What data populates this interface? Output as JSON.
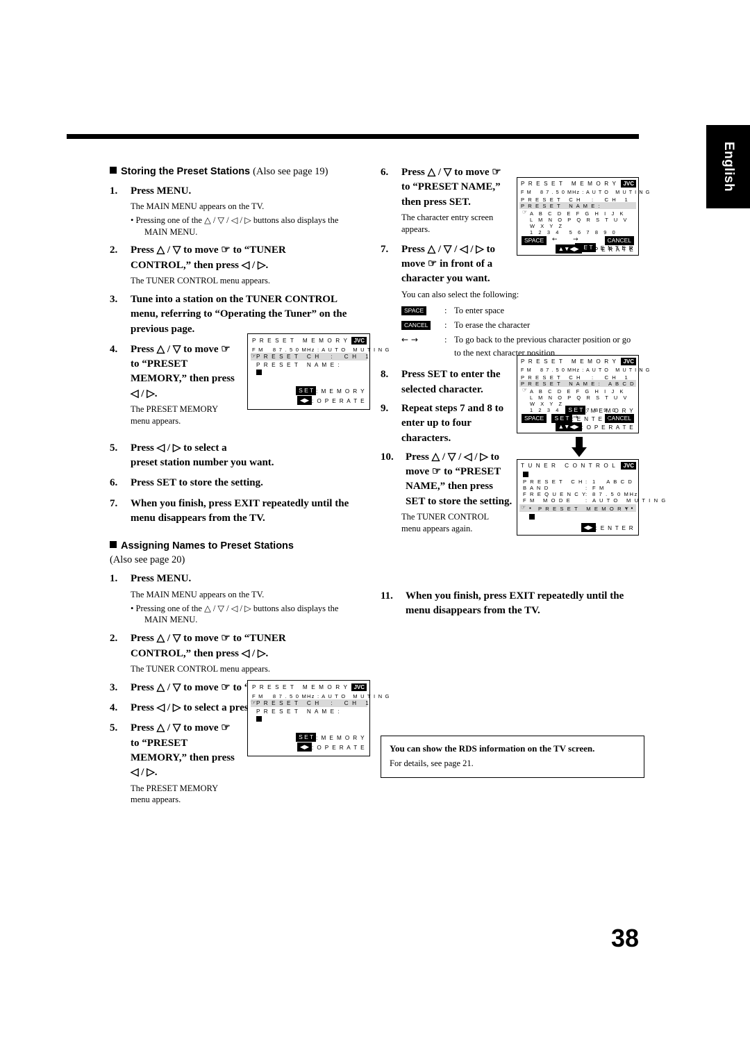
{
  "page": {
    "number": "38",
    "language_tab": "English"
  },
  "left_column": {
    "section1": {
      "title_bold": "Storing the Preset Stations",
      "title_thin": "(Also see page 19)",
      "steps": [
        {
          "num": "1.",
          "text": "Press MENU.",
          "note": "The MAIN MENU appears on the TV.",
          "bullet_line1": "• Pressing one of the △ / ▽ / ◁ / ▷ buttons also displays the",
          "bullet_line2": "MAIN MENU."
        },
        {
          "num": "2.",
          "text_line1": "Press △ / ▽ to move ☞ to “TUNER",
          "text_line2": "CONTROL,” then press ◁ / ▷.",
          "note": "The TUNER CONTROL menu appears."
        },
        {
          "num": "3.",
          "text_line1": "Tune into a station on the TUNER CONTROL",
          "text_line2": "menu, referring to “Operating the Tuner” on the",
          "text_line3": "previous page."
        },
        {
          "num": "4.",
          "text_line1": "Press △ / ▽ to move ☞",
          "text_line2": "to “PRESET",
          "text_line3": "MEMORY,” then press",
          "text_line4": "◁ / ▷.",
          "note_line1": "The PRESET MEMORY",
          "note_line2": "menu appears."
        },
        {
          "num": "5.",
          "text_line1": "Press ◁ / ▷ to select a",
          "text_line2": "preset station number you want."
        },
        {
          "num": "6.",
          "text": "Press SET to store the setting."
        },
        {
          "num": "7.",
          "text_line1": "When you finish, press EXIT repeatedly until the",
          "text_line2": "menu disappears from the TV."
        }
      ]
    },
    "section2": {
      "title_bold": "Assigning Names to Preset Stations",
      "title_thin": "(Also see page 20)",
      "steps": [
        {
          "num": "1.",
          "text": "Press MENU.",
          "note": "The MAIN MENU appears on the TV.",
          "bullet_line1": "• Pressing one of the △ / ▽ / ◁ / ▷ buttons also displays the",
          "bullet_line2": "MAIN MENU."
        },
        {
          "num": "2.",
          "text_line1": "Press △ / ▽ to move ☞ to “TUNER",
          "text_line2": "CONTROL,” then press ◁ / ▷.",
          "note": "The TUNER CONTROL menu appears."
        },
        {
          "num": "3.",
          "text": "Press △ / ▽ to move ☞ to “PRESET CH.”"
        },
        {
          "num": "4.",
          "text": "Press ◁ / ▷ to select a preset station."
        },
        {
          "num": "5.",
          "text_line1": "Press △ / ▽ to move ☞",
          "text_line2": "to “PRESET",
          "text_line3": "MEMORY,” then press",
          "text_line4": "◁ / ▷.",
          "note_line1": "The PRESET MEMORY",
          "note_line2": "menu appears."
        }
      ]
    }
  },
  "right_column": {
    "steps": [
      {
        "num": "6.",
        "text_line1": "Press △ / ▽ to move ☞",
        "text_line2": "to “PRESET NAME,”",
        "text_line3": "then press SET.",
        "note_line1": "The character entry screen",
        "note_line2": "appears."
      },
      {
        "num": "7.",
        "text_line1": "Press △ / ▽ / ◁ / ▷ to",
        "text_line2": "move ☞ in front of a",
        "text_line3": "character you want.",
        "note": "You can also select the following:"
      },
      {
        "num": "8.",
        "text_line1": "Press SET to enter the",
        "text_line2": "selected character."
      },
      {
        "num": "9.",
        "text_line1": "Repeat steps 7 and 8 to",
        "text_line2": "enter up to four",
        "text_line3": "characters."
      },
      {
        "num": "10.",
        "text_line1": "Press △ / ▽ / ◁ / ▷ to",
        "text_line2": "move ☞ to “PRESET",
        "text_line3": "NAME,” then press",
        "text_line4": "SET to store the setting.",
        "note_line1": "The TUNER CONTROL",
        "note_line2": "menu appears again."
      },
      {
        "num": "11.",
        "text_line1": "When you finish, press EXIT repeatedly until the",
        "text_line2": "menu disappears from the TV."
      }
    ],
    "keys": [
      {
        "key": "SPACE",
        "colon": ":",
        "desc": "To enter space"
      },
      {
        "key": "CANCEL",
        "colon": ":",
        "desc": "To erase the character"
      },
      {
        "key": "← →",
        "colon": ":",
        "desc_line1": "To go back to the previous character position or go",
        "desc_line2": "to the next character position"
      }
    ],
    "rds_note": {
      "line1": "You can show the RDS information on the TV screen.",
      "line2": "For details, see page 21."
    }
  },
  "screens": {
    "preset_memory_1": {
      "title": "P R E S E T   M E M O R Y",
      "brand": "JVC",
      "line_freq": "F M    8 7 . 5 0 MHz : A U T O   M U T I N G",
      "row_ch": "P R E S E T   C H    :    C H   1",
      "row_name": "P R E S E T   N A M E :",
      "footer_set": "S E T",
      "footer_set_val": ": M E M O R Y",
      "footer_nav": ": O P E R A T E"
    },
    "preset_memory_2": {
      "title": "P R E S E T   M E M O R Y",
      "brand": "JVC",
      "line_freq": "F M    8 7 . 5 0 MHz : A U T O   M U T I N G",
      "row_ch": "P R E S E T   C H    :    C H   1",
      "row_name": "P R E S E T   N A M E :",
      "footer_set": "S E T",
      "footer_set_val": ": M E M O R Y",
      "footer_nav": ": O P E R A T E"
    },
    "char_entry_1": {
      "title": "P R E S E T   M E M O R Y",
      "brand": "JVC",
      "line_freq": "F M    8 7 . 5 0 MHz : A U T O   M U T I N G",
      "row_ch": "P R E S E T   C H    :    C H   1",
      "row_name": "P R E S E T   N A M E :",
      "grid": [
        "A  B  C  D  E  F  G  H  I  J  K",
        "L  M  N  O  P  Q  R  S  T  U  V",
        "W  X  Y  Z",
        "1  2  3  4    5  6  7  8  9  0"
      ],
      "space_key": "SPACE",
      "cancel_key": "CANCEL",
      "footer_enter": "S E T",
      "footer_enter_val": ": E N T E R",
      "footer_nav": ": O P E R A T E"
    },
    "char_entry_2": {
      "title": "P R E S E T   M E M O R Y",
      "brand": "JVC",
      "line_freq": "F M    8 7 . 5 0 MHz : A U T O   M U T I N G",
      "row_ch": "P R E S E T   C H    :    C H   1",
      "row_name": "P R E S E T   N A M E :   A B C D",
      "grid": [
        "A  B  C  D  E  F  G  H  I  J  K",
        "L  M  N  O  P  Q  R  S  T  U  V",
        "W  X  Y  Z",
        "1  2  3  4    5  6  7  8  9  0"
      ],
      "space_key": "SPACE",
      "cancel_key": "CANCEL",
      "footer_memory": "S E T",
      "footer_memory_val": ": M E M O R Y",
      "footer_enter": "S E T",
      "footer_enter_val": ": E N T E R",
      "footer_nav": ": O P E R A T E"
    },
    "tuner_control": {
      "title": "T U N E R   C O N T R O L",
      "brand": "JVC",
      "rows": [
        {
          "label": "P R E S E T   C H",
          "sep": ":",
          "value": "1    A B C D"
        },
        {
          "label": "B A N D",
          "sep": ":",
          "value": "F M"
        },
        {
          "label": "F R E Q U E N C Y",
          "sep": ":",
          "value": "8 7 . 5 0 MHz"
        },
        {
          "label": "F M   M O D E",
          "sep": ":",
          "value": "A U T O   M U T I N G"
        }
      ],
      "bottom_row": "P R E S E T   M E M O R Y",
      "footer_enter": ": E N T E R"
    }
  }
}
